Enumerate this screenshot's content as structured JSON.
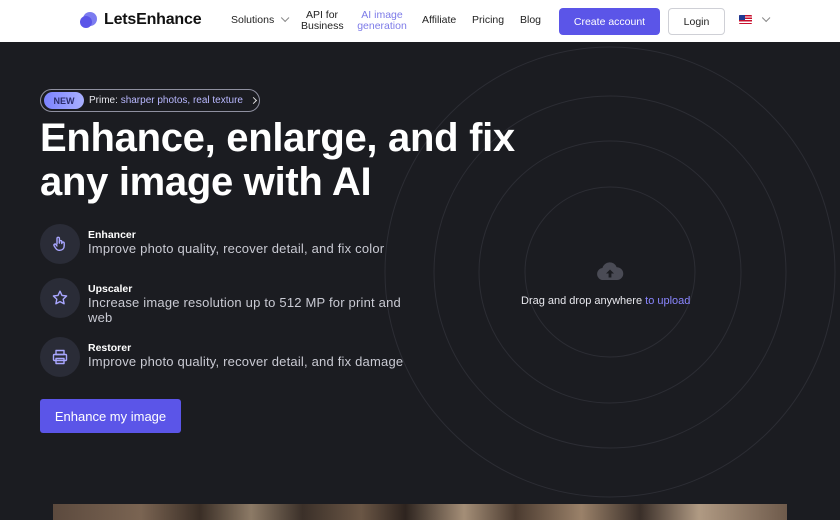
{
  "header": {
    "brand": "LetsEnhance",
    "nav": {
      "solutions": "Solutions",
      "api_line1": "API for",
      "api_line2": "Business",
      "ai_line1": "AI image",
      "ai_line2": "generation",
      "affiliate": "Affiliate",
      "pricing": "Pricing",
      "blog": "Blog"
    },
    "create_account": "Create account",
    "login": "Login"
  },
  "hero": {
    "badge_new": "NEW",
    "badge_text_prefix": "Prime:",
    "badge_text_highlight": "sharper photos, real texture",
    "title_line1": "Enhance, enlarge, and fix",
    "title_line2": "any image with AI",
    "features": [
      {
        "title": "Enhancer",
        "desc": "Improve photo quality, recover detail, and fix color",
        "icon": "hand-pointer-icon"
      },
      {
        "title": "Upscaler",
        "desc": "Increase image resolution up to 512 MP for print and web",
        "icon": "star-icon"
      },
      {
        "title": "Restorer",
        "desc": "Improve photo quality, recover detail, and fix damage",
        "icon": "printer-icon"
      }
    ],
    "cta": "Enhance my image"
  },
  "upload": {
    "icon": "cloud-upload-icon",
    "text": "Drag and drop anywhere",
    "link": "to upload"
  },
  "colors": {
    "accent": "#5b55e8",
    "background": "#1b1c21",
    "link": "#8a86ff"
  }
}
